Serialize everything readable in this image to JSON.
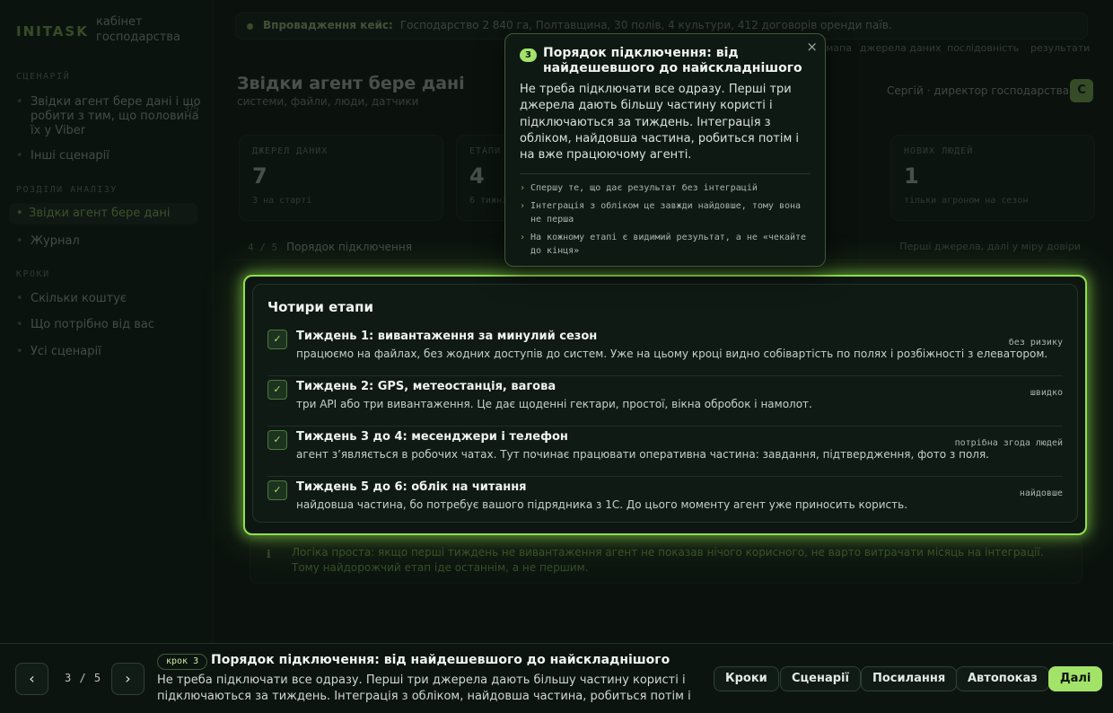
{
  "colors": {
    "accent": "#a3e36a",
    "background": "#0b120e",
    "highlight": "#8fe04e"
  },
  "sidebar": {
    "brand": "INITASK",
    "brand_sub": "кабінет господарства",
    "sections": [
      {
        "label": "СЦЕНАРІЙ"
      },
      {
        "label": "РОЗДІЛИ АНАЛІЗУ"
      },
      {
        "label": "КРОКИ"
      }
    ],
    "items": [
      {
        "label": "Звідки агент бере дані і що робити з тим, що половина їх у Viber",
        "count": "3/5"
      },
      {
        "label": "Інші сценарії"
      },
      {
        "label": "Звідки агент бере дані"
      },
      {
        "label": "Журнал"
      },
      {
        "label": "Скільки коштує"
      },
      {
        "label": "Що потрібно від вас"
      },
      {
        "label": "Усі сценарії"
      }
    ]
  },
  "banner": {
    "label": "Впровадження кейс:",
    "text": "Господарство 2 840 га, Полтавщина, 30 полів, 4 культури, 412 договорів оренди паїв."
  },
  "crumbs": [
    "мапа",
    "джерела даних",
    "послідовність",
    "результати"
  ],
  "header": {
    "title": "Звідки агент бере дані",
    "subtitle": "системи, файли, люди, датчики",
    "user": "Сергій · директор господарства",
    "avatar": "С"
  },
  "stats": [
    {
      "label": "ДЖЕРЕЛ ДАНИХ",
      "value": "7",
      "sub": "3 на старті"
    },
    {
      "label": "ЕТАПИ",
      "value": "4",
      "sub": "6 тижнів"
    },
    {
      "label": "НОВИХ ЛЮДЕЙ",
      "value": "1",
      "sub": "тільки агроном на сезон"
    }
  ],
  "section": {
    "num": "4 / 5",
    "title": "Порядок підключення",
    "hint": "Перші джерела, далі у міру довіри"
  },
  "card": {
    "title": "Чотири етапи",
    "stages": [
      {
        "title": "Тиждень 1: вивантаження за минулий сезон",
        "desc": "працюємо на файлах, без жодних доступів до систем. Уже на цьому кроці видно собівартість по полях і розбіжності з елеватором.",
        "tag": "без ризику"
      },
      {
        "title": "Тиждень 2: GPS, метеостанція, вагова",
        "desc": "три API або три вивантаження. Це дає щоденні гектари, простої, вікна обробок і намолот.",
        "tag": "швидко"
      },
      {
        "title": "Тиждень 3 до 4: месенджери і телефон",
        "desc": "агент з’являється в робочих чатах. Тут починає працювати оперативна частина: завдання, підтвердження, фото з поля.",
        "tag": "потрібна згода людей"
      },
      {
        "title": "Тиждень 5 до 6: облік на читання",
        "desc": "найдовша частина, бо потребує вашого підрядника з 1С. До цього моменту агент уже приносить користь.",
        "tag": "найдовше"
      }
    ]
  },
  "note": {
    "text": "Логіка проста: якщо перші тиждень не вивантаження агент не показав нічого корисного, не варто витрачати місяць на інтеграції. Тому найдорожчий етап іде останнім, а не першим."
  },
  "popover": {
    "step": "3",
    "title": "Порядок підключення: від найдешевшого до найскладнішого",
    "body": "Не треба підключати все одразу. Перші три джерела дають більшу частину користі і підключаються за тиждень. Інтеграція з обліком, найдовша частина, робиться потім і на вже працюючому агенті.",
    "points": [
      "Спершу те, що дає результат без інтеграцій",
      "Інтеграція з обліком це завжди найдовше, тому вона не перша",
      "На кожному етапі є видимий результат, а не «чекайте до кінця»"
    ],
    "close": "×"
  },
  "bottom": {
    "prev": "‹",
    "next": "›",
    "pager": "3 / 5",
    "step_pill": "крок 3",
    "step_title": "Порядок підключення: від найдешевшого до найскладнішого",
    "step_desc": "Не треба підключати все одразу. Перші три джерела дають більшу частину користі і підключаються за тиждень. Інтеграція з обліком, найдовша частина, робиться потім і на вж…",
    "buttons": [
      "Кроки",
      "Сценарії",
      "Посилання",
      "Автопоказ"
    ],
    "primary": "Далі"
  }
}
